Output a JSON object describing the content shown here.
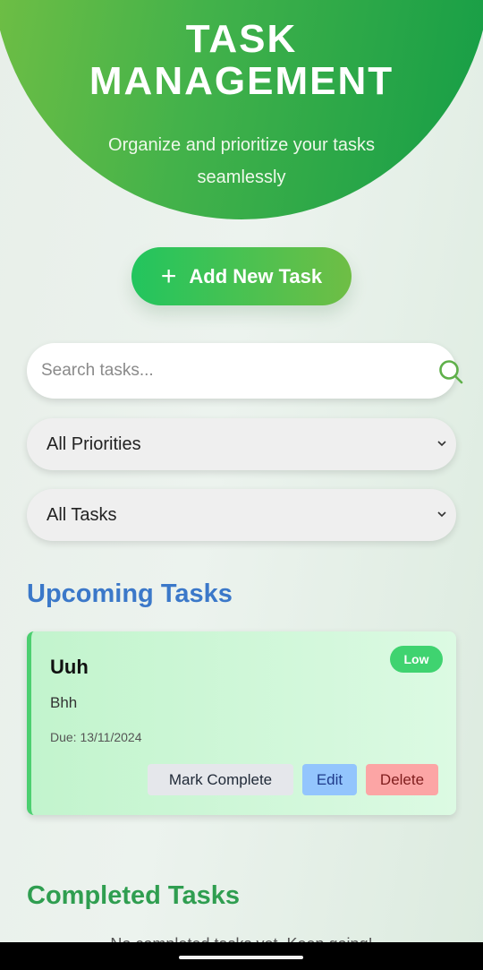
{
  "header": {
    "title_line1": "TASK",
    "title_line2": "MANAGEMENT",
    "subtitle_line1": "Organize and prioritize your tasks",
    "subtitle_line2": "seamlessly"
  },
  "add_button": {
    "icon": "plus-icon",
    "label": "Add New Task"
  },
  "search": {
    "placeholder": "Search tasks...",
    "value": "",
    "icon": "search-icon"
  },
  "filters": {
    "priority": {
      "selected": "All Priorities",
      "icon": "chevron-down-icon"
    },
    "status": {
      "selected": "All Tasks",
      "icon": "chevron-down-icon"
    }
  },
  "sections": {
    "upcoming_title": "Upcoming Tasks",
    "completed_title": "Completed Tasks",
    "completed_empty_text": "No completed tasks yet. Keep going!"
  },
  "tasks": [
    {
      "title": "Uuh",
      "description": "Bhh",
      "due": "Due: 13/11/2024",
      "priority": "Low",
      "actions": {
        "complete": "Mark Complete",
        "edit": "Edit",
        "delete": "Delete"
      }
    }
  ],
  "colors": {
    "header_gradient": [
      "#79c143",
      "#149d46"
    ],
    "add_button_gradient": [
      "#22c55e",
      "#6fbe45"
    ],
    "upcoming_title": "#3b78c9",
    "completed_title": "#2f9e50",
    "priority_low": "#3fd370",
    "card_accent": "#4ccf70"
  }
}
